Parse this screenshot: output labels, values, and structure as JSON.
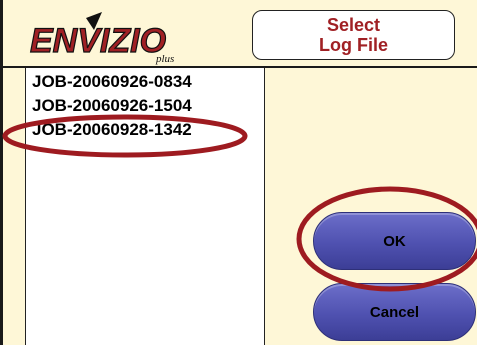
{
  "header": {
    "logo_text": "ENVIZIO",
    "logo_suffix": "plus",
    "title_line1": "Select",
    "title_line2": "Log File"
  },
  "log_files": [
    "JOB-20060926-0834",
    "JOB-20060926-1504",
    "JOB-20060928-1342"
  ],
  "buttons": {
    "ok_label": "OK",
    "cancel_label": "Cancel"
  },
  "colors": {
    "background": "#fef7d7",
    "title_text": "#a02024",
    "button_fill": "#4f51b0",
    "annotation_ring": "#9e1b20"
  }
}
